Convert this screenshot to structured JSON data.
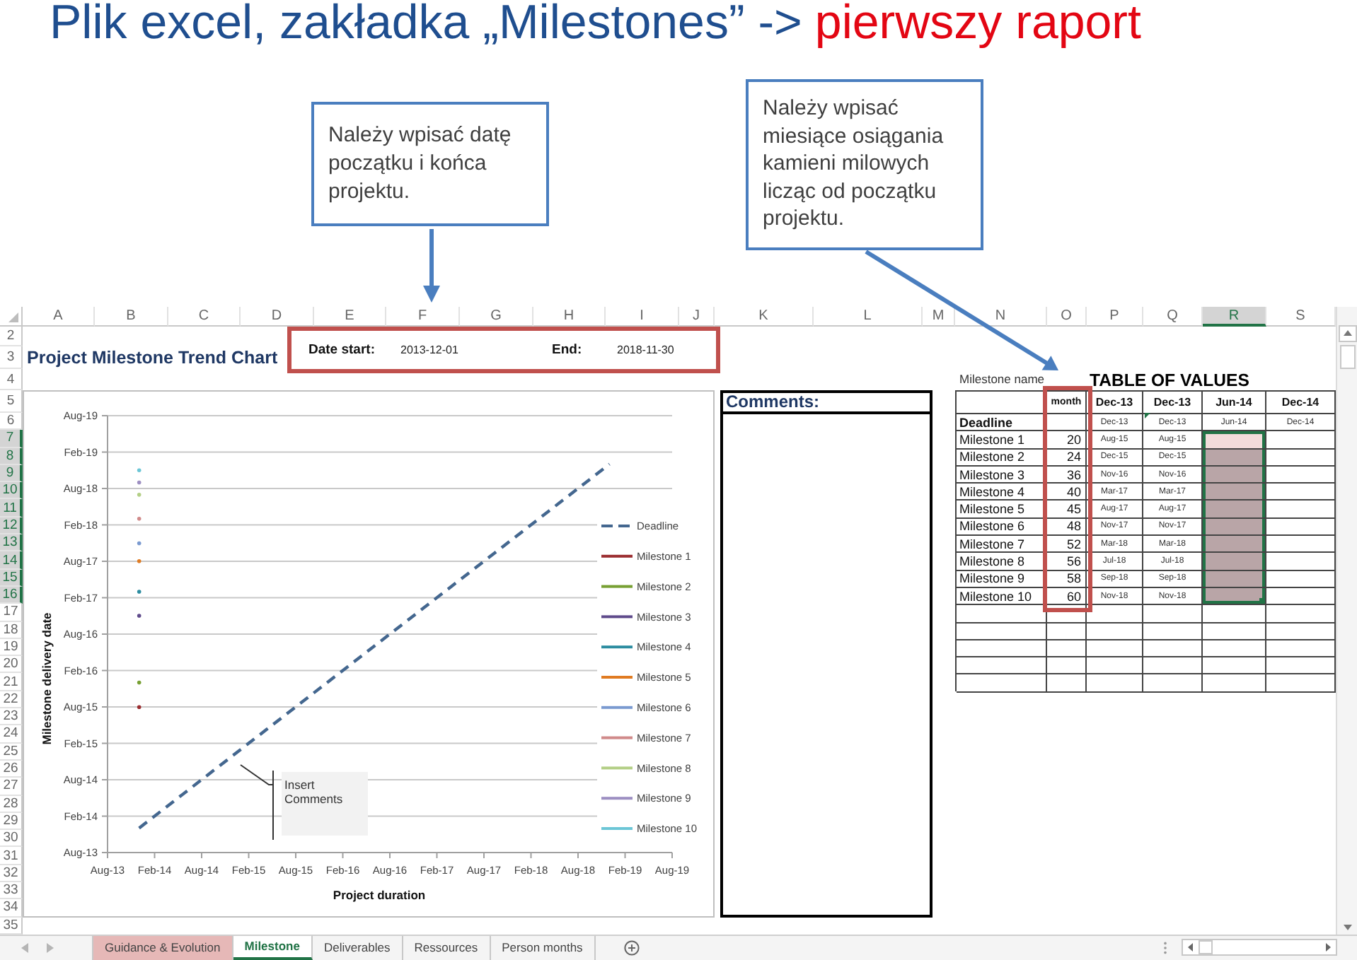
{
  "slide": {
    "title": "Plik excel, zakładka „Milestones” ->",
    "title_highlight": "pierwszy raport"
  },
  "callouts": [
    {
      "text": "Należy wpisać datę początku i końca projektu."
    },
    {
      "text": "Należy wpisać miesiące osiągania kamieni milowych licząc od początku projektu."
    }
  ],
  "spreadsheet": {
    "columns": [
      {
        "label": "A",
        "selected": false
      },
      {
        "label": "B",
        "selected": false
      },
      {
        "label": "C",
        "selected": false
      },
      {
        "label": "D",
        "selected": false
      },
      {
        "label": "E",
        "selected": false
      },
      {
        "label": "F",
        "selected": false
      },
      {
        "label": "G",
        "selected": false
      },
      {
        "label": "H",
        "selected": false
      },
      {
        "label": "I",
        "selected": false
      },
      {
        "label": "J",
        "selected": false
      },
      {
        "label": "K",
        "selected": false
      },
      {
        "label": "L",
        "selected": false
      },
      {
        "label": "M",
        "selected": false
      },
      {
        "label": "N",
        "selected": false
      },
      {
        "label": "O",
        "selected": false
      },
      {
        "label": "P",
        "selected": false
      },
      {
        "label": "Q",
        "selected": false
      },
      {
        "label": "R",
        "selected": true
      },
      {
        "label": "S",
        "selected": false
      }
    ],
    "rows": [
      {
        "label": "2",
        "selected": false
      },
      {
        "label": "3",
        "selected": false
      },
      {
        "label": "4",
        "selected": false
      },
      {
        "label": "5",
        "selected": false
      },
      {
        "label": "6",
        "selected": false
      },
      {
        "label": "7",
        "selected": true
      },
      {
        "label": "8",
        "selected": true
      },
      {
        "label": "9",
        "selected": true
      },
      {
        "label": "10",
        "selected": true
      },
      {
        "label": "11",
        "selected": true
      },
      {
        "label": "12",
        "selected": true
      },
      {
        "label": "13",
        "selected": true
      },
      {
        "label": "14",
        "selected": true
      },
      {
        "label": "15",
        "selected": true
      },
      {
        "label": "16",
        "selected": true
      },
      {
        "label": "17",
        "selected": false
      },
      {
        "label": "18",
        "selected": false
      },
      {
        "label": "19",
        "selected": false
      },
      {
        "label": "20",
        "selected": false
      },
      {
        "label": "21",
        "selected": false
      },
      {
        "label": "22",
        "selected": false
      },
      {
        "label": "23",
        "selected": false
      },
      {
        "label": "24",
        "selected": false
      },
      {
        "label": "25",
        "selected": false
      },
      {
        "label": "26",
        "selected": false
      },
      {
        "label": "27",
        "selected": false
      },
      {
        "label": "28",
        "selected": false
      },
      {
        "label": "29",
        "selected": false
      },
      {
        "label": "30",
        "selected": false
      },
      {
        "label": "31",
        "selected": false
      },
      {
        "label": "32",
        "selected": false
      },
      {
        "label": "33",
        "selected": false
      },
      {
        "label": "34",
        "selected": false
      },
      {
        "label": "35",
        "selected": false
      }
    ],
    "sheet_title": "Project Milestone Trend Chart",
    "dates": {
      "start_label": "Date start:",
      "start_value": "2013-12-01",
      "end_label": "End:",
      "end_value": "2018-11-30"
    },
    "chart": {
      "y_axis_title": "Milestone delivery date",
      "x_axis_title": "Project duration",
      "y_tick_labels": [
        "Aug-19",
        "Feb-19",
        "Aug-18",
        "Feb-18",
        "Aug-17",
        "Feb-17",
        "Aug-16",
        "Feb-16",
        "Aug-15",
        "Feb-15",
        "Aug-14",
        "Feb-14",
        "Aug-13"
      ],
      "x_tick_labels": [
        "Aug-13",
        "Feb-14",
        "Aug-14",
        "Feb-15",
        "Aug-15",
        "Feb-16",
        "Aug-16",
        "Feb-17",
        "Aug-17",
        "Feb-18",
        "Aug-18",
        "Feb-19",
        "Aug-19"
      ],
      "legend": [
        {
          "label": "Deadline",
          "kind": "dashed",
          "color": "#44678f"
        },
        {
          "label": "Milestone 1",
          "kind": "solid",
          "color": "#9b2d30"
        },
        {
          "label": "Milestone 2",
          "kind": "solid",
          "color": "#77a033"
        },
        {
          "label": "Milestone 3",
          "kind": "solid",
          "color": "#5f4b8b"
        },
        {
          "label": "Milestone 4",
          "kind": "solid",
          "color": "#2c8ca0"
        },
        {
          "label": "Milestone 5",
          "kind": "solid",
          "color": "#e07b22"
        },
        {
          "label": "Milestone 6",
          "kind": "solid",
          "color": "#7a9ad0"
        },
        {
          "label": "Milestone 7",
          "kind": "solid",
          "color": "#d08a8a"
        },
        {
          "label": "Milestone 8",
          "kind": "solid",
          "color": "#b3cf86"
        },
        {
          "label": "Milestone 9",
          "kind": "solid",
          "color": "#9d8fc2"
        },
        {
          "label": "Milestone 10",
          "kind": "solid",
          "color": "#6cc6d6"
        }
      ],
      "note": "Insert Comments"
    },
    "comments": {
      "title": "Comments:"
    },
    "values_table": {
      "caption": "Milestone name",
      "title": "TABLE OF VALUES",
      "header": [
        "month",
        "Dec-13",
        "Dec-13",
        "Jun-14",
        "Dec-14"
      ],
      "rows": [
        {
          "kind": "deadline",
          "name": "Deadline",
          "cells": [
            {
              "text": "Dec-13",
              "selected": false,
              "active": false
            },
            {
              "text": "Dec-13",
              "selected": false,
              "active": false
            },
            {
              "text": "Jun-14",
              "selected": false,
              "active": false
            },
            {
              "text": "Dec-14",
              "selected": false,
              "active": false
            }
          ]
        },
        {
          "kind": "milestone",
          "name": "Milestone 1",
          "month": "20",
          "cells": [
            {
              "text": "Aug-15",
              "selected": false,
              "active": false
            },
            {
              "text": "Aug-15",
              "selected": false,
              "active": false
            },
            {
              "selected": true,
              "active": true
            },
            {
              "selected": false,
              "active": false
            }
          ]
        },
        {
          "kind": "milestone",
          "name": "Milestone 2",
          "month": "24",
          "cells": [
            {
              "text": "Dec-15",
              "selected": false,
              "active": false
            },
            {
              "text": "Dec-15",
              "selected": false,
              "active": false
            },
            {
              "selected": true,
              "active": false
            },
            {
              "selected": false,
              "active": false
            }
          ]
        },
        {
          "kind": "milestone",
          "name": "Milestone 3",
          "month": "36",
          "cells": [
            {
              "text": "Nov-16",
              "selected": false,
              "active": false
            },
            {
              "text": "Nov-16",
              "selected": false,
              "active": false
            },
            {
              "selected": true,
              "active": false
            },
            {
              "selected": false,
              "active": false
            }
          ]
        },
        {
          "kind": "milestone",
          "name": "Milestone 4",
          "month": "40",
          "cells": [
            {
              "text": "Mar-17",
              "selected": false,
              "active": false
            },
            {
              "text": "Mar-17",
              "selected": false,
              "active": false
            },
            {
              "selected": true,
              "active": false
            },
            {
              "selected": false,
              "active": false
            }
          ]
        },
        {
          "kind": "milestone",
          "name": "Milestone 5",
          "month": "45",
          "cells": [
            {
              "text": "Aug-17",
              "selected": false,
              "active": false
            },
            {
              "text": "Aug-17",
              "selected": false,
              "active": false
            },
            {
              "selected": true,
              "active": false
            },
            {
              "selected": false,
              "active": false
            }
          ]
        },
        {
          "kind": "milestone",
          "name": "Milestone 6",
          "month": "48",
          "cells": [
            {
              "text": "Nov-17",
              "selected": false,
              "active": false
            },
            {
              "text": "Nov-17",
              "selected": false,
              "active": false
            },
            {
              "selected": true,
              "active": false
            },
            {
              "selected": false,
              "active": false
            }
          ]
        },
        {
          "kind": "milestone",
          "name": "Milestone 7",
          "month": "52",
          "cells": [
            {
              "text": "Mar-18",
              "selected": false,
              "active": false
            },
            {
              "text": "Mar-18",
              "selected": false,
              "active": false
            },
            {
              "selected": true,
              "active": false
            },
            {
              "selected": false,
              "active": false
            }
          ]
        },
        {
          "kind": "milestone",
          "name": "Milestone 8",
          "month": "56",
          "cells": [
            {
              "text": "Jul-18",
              "selected": false,
              "active": false
            },
            {
              "text": "Jul-18",
              "selected": false,
              "active": false
            },
            {
              "selected": true,
              "active": false
            },
            {
              "selected": false,
              "active": false
            }
          ]
        },
        {
          "kind": "milestone",
          "name": "Milestone 9",
          "month": "58",
          "cells": [
            {
              "text": "Sep-18",
              "selected": false,
              "active": false
            },
            {
              "text": "Sep-18",
              "selected": false,
              "active": false
            },
            {
              "selected": true,
              "active": false
            },
            {
              "selected": false,
              "active": false
            }
          ]
        },
        {
          "kind": "milestone",
          "name": "Milestone 10",
          "month": "60",
          "cells": [
            {
              "text": "Nov-18",
              "selected": false,
              "active": false
            },
            {
              "text": "Nov-18",
              "selected": false,
              "active": false
            },
            {
              "selected": true,
              "active": false
            },
            {
              "selected": false,
              "active": false
            }
          ]
        }
      ]
    },
    "sheet_tabs": [
      {
        "label": "Guidance & Evolution",
        "selected": false,
        "color": "#e6b8b7"
      },
      {
        "label": "Milestone",
        "selected": true
      },
      {
        "label": "Deliverables",
        "selected": false
      },
      {
        "label": "Ressources",
        "selected": false
      },
      {
        "label": "Person months",
        "selected": false
      }
    ]
  }
}
